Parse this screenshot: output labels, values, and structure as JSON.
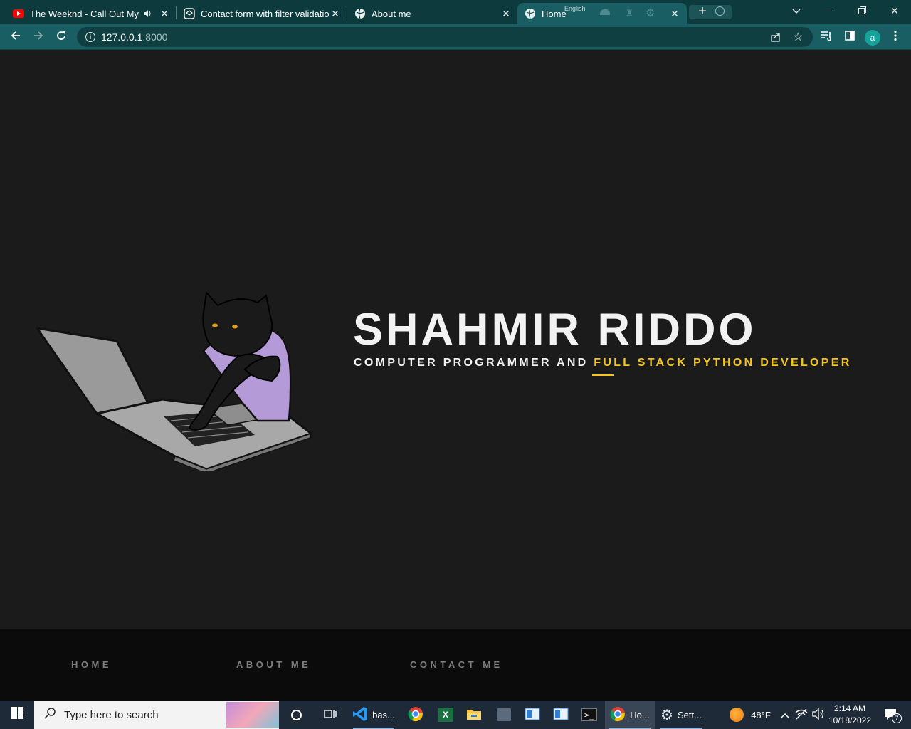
{
  "browser": {
    "tabs": [
      {
        "title": "The Weeknd - Call Out My Name",
        "favicon": "youtube-icon",
        "audio": true
      },
      {
        "title": "Contact form with filter validation",
        "favicon": "codepen-icon"
      },
      {
        "title": "About me",
        "favicon": "globe-icon"
      },
      {
        "title": "Home",
        "favicon": "globe-icon",
        "active": true
      }
    ],
    "tab_overlay_text": "English",
    "url_host": "127.0.0.1",
    "url_port": ":8000",
    "profile_initial": "a"
  },
  "hero": {
    "name": "SHAHMIR RIDDO",
    "role_plain": "COMPUTER PROGRAMMER AND ",
    "role_highlight": "FULL STACK PYTHON DEVELOPER",
    "illustration": "cat-typing-on-laptop"
  },
  "footer": {
    "links": [
      "HOME",
      "ABOUT ME",
      "CONTACT ME"
    ]
  },
  "taskbar": {
    "search_placeholder": "Type here to search",
    "apps": [
      {
        "name": "VS Code",
        "label": "bas..."
      },
      {
        "name": "Chrome",
        "label": "Ho..."
      },
      {
        "name": "Settings",
        "label": "Sett..."
      }
    ],
    "weather": "48°F",
    "time": "2:14 AM",
    "date": "10/18/2022",
    "notifications": "7"
  },
  "colors": {
    "accent": "#f5c518",
    "page_bg": "#1b1b1c",
    "footer_bg": "#0b0b0c",
    "browser_frame": "#195e62"
  }
}
